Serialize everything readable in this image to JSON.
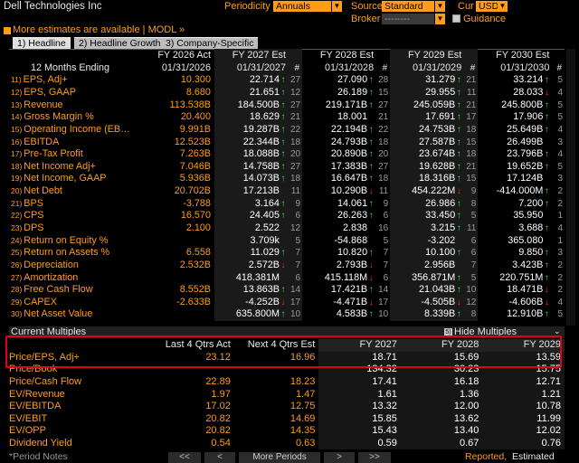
{
  "header": {
    "title": "Dell Technologies Inc",
    "periodicity_label": "Periodicity",
    "periodicity_value": "Annuals",
    "source_label": "Source",
    "source_value": "Standard",
    "cur_label": "Cur",
    "cur_value": "USD",
    "broker_label": "Broker",
    "broker_value": "--------",
    "guidance_label": "Guidance"
  },
  "notice": {
    "icon": "square-icon",
    "text": "More estimates are available | MODL »"
  },
  "tabs": [
    {
      "label": "1) Headline"
    },
    {
      "label": "2) Headline Growth"
    },
    {
      "label": "3) Company-Specific"
    }
  ],
  "columns": {
    "c1_top": "FY 2026 Act",
    "c1_bot": "01/31/2026",
    "c2_top": "FY 2027 Est",
    "c2_bot": "01/31/2027",
    "c3_top": "FY 2028 Est",
    "c3_bot": "01/31/2028",
    "c4_top": "FY 2029 Est",
    "c4_bot": "01/31/2029",
    "c5_top": "FY 2030 Est",
    "c5_bot": "01/31/2030",
    "row_label": "12 Months Ending",
    "hash": "#"
  },
  "rows": [
    {
      "n": "11)",
      "label": "EPS, Adj+",
      "a": "10.300",
      "b": "22.714",
      "ba": "u",
      "bn": "27",
      "c": "27.090",
      "ca": "u",
      "cn": "28",
      "d": "31.279",
      "da": "u",
      "dn": "21",
      "e": "33.214",
      "ea": "u",
      "en": "5"
    },
    {
      "n": "12)",
      "label": "EPS, GAAP",
      "a": "8.680",
      "b": "21.651",
      "ba": "u",
      "bn": "12",
      "c": "26.189",
      "ca": "u",
      "cn": "15",
      "d": "29.955",
      "da": "u",
      "dn": "11",
      "e": "28.033",
      "ea": "d",
      "en": "4"
    },
    {
      "n": "13)",
      "label": "Revenue",
      "a": "113.538B",
      "b": "184.500B",
      "ba": "u",
      "bn": "27",
      "c": "219.171B",
      "ca": "u",
      "cn": "27",
      "d": "245.059B",
      "da": "u",
      "dn": "21",
      "e": "245.800B",
      "ea": "u",
      "en": "5"
    },
    {
      "n": "14)",
      "label": "Gross Margin %",
      "a": "20.400",
      "b": "18.629",
      "ba": "u",
      "bn": "21",
      "c": "18.001",
      "ca": "",
      "cn": "21",
      "d": "17.691",
      "da": "u",
      "dn": "17",
      "e": "17.906",
      "ea": "u",
      "en": "5"
    },
    {
      "n": "15)",
      "label": "Operating Income (EB…",
      "a": "9.991B",
      "b": "19.287B",
      "ba": "u",
      "bn": "22",
      "c": "22.194B",
      "ca": "u",
      "cn": "22",
      "d": "24.753B",
      "da": "u",
      "dn": "18",
      "e": "25.649B",
      "ea": "u",
      "en": "4"
    },
    {
      "n": "16)",
      "label": "EBITDA",
      "a": "12.523B",
      "b": "22.344B",
      "ba": "u",
      "bn": "18",
      "c": "24.793B",
      "ca": "u",
      "cn": "18",
      "d": "27.587B",
      "da": "u",
      "dn": "15",
      "e": "26.499B",
      "ea": "",
      "en": "3"
    },
    {
      "n": "17)",
      "label": "Pre-Tax Profit",
      "a": "7.263B",
      "b": "18.088B",
      "ba": "u",
      "bn": "20",
      "c": "20.890B",
      "ca": "u",
      "cn": "20",
      "d": "23.674B",
      "da": "u",
      "dn": "18",
      "e": "23.796B",
      "ea": "u",
      "en": "4"
    },
    {
      "n": "18)",
      "label": "Net Income Adj+",
      "a": "7.046B",
      "b": "14.758B",
      "ba": "u",
      "bn": "27",
      "c": "17.383B",
      "ca": "u",
      "cn": "27",
      "d": "19.628B",
      "da": "u",
      "dn": "21",
      "e": "19.652B",
      "ea": "u",
      "en": "5"
    },
    {
      "n": "19)",
      "label": "Net Income, GAAP",
      "a": "5.936B",
      "b": "14.073B",
      "ba": "u",
      "bn": "18",
      "c": "16.647B",
      "ca": "u",
      "cn": "18",
      "d": "18.316B",
      "da": "u",
      "dn": "15",
      "e": "17.124B",
      "ea": "",
      "en": "3"
    },
    {
      "n": "20)",
      "label": "Net Debt",
      "a": "20.702B",
      "b": "17.213B",
      "ba": "",
      "bn": "11",
      "c": "10.290B",
      "ca": "d",
      "cn": "11",
      "d": "454.222M",
      "da": "d",
      "dn": "9",
      "e": "-414.000M",
      "ea": "u",
      "en": "2"
    },
    {
      "n": "21)",
      "label": "BPS",
      "a": "-3.788",
      "b": "3.164",
      "ba": "u",
      "bn": "9",
      "c": "14.061",
      "ca": "u",
      "cn": "9",
      "d": "26.986",
      "da": "u",
      "dn": "8",
      "e": "7.200",
      "ea": "u",
      "en": "2"
    },
    {
      "n": "22)",
      "label": "CPS",
      "a": "16.570",
      "b": "24.405",
      "ba": "u",
      "bn": "6",
      "c": "26.263",
      "ca": "u",
      "cn": "6",
      "d": "33.450",
      "da": "u",
      "dn": "5",
      "e": "35.950",
      "ea": "",
      "en": "1"
    },
    {
      "n": "23)",
      "label": "DPS",
      "a": "2.100",
      "b": "2.522",
      "ba": "",
      "bn": "12",
      "c": "2.838",
      "ca": "",
      "cn": "16",
      "d": "3.215",
      "da": "u",
      "dn": "11",
      "e": "3.688",
      "ea": "u",
      "en": "4"
    },
    {
      "n": "24)",
      "label": "Return on Equity %",
      "a": "",
      "b": "3.709k",
      "ba": "",
      "bn": "5",
      "c": "-54.868",
      "ca": "",
      "cn": "5",
      "d": "-3.202",
      "da": "",
      "dn": "6",
      "e": "365.080",
      "ea": "",
      "en": "1"
    },
    {
      "n": "25)",
      "label": "Return on Assets %",
      "a": "6.558",
      "b": "11.029",
      "ba": "u",
      "bn": "7",
      "c": "10.820",
      "ca": "u",
      "cn": "7",
      "d": "10.100",
      "da": "u",
      "dn": "6",
      "e": "9.850",
      "ea": "u",
      "en": "3"
    },
    {
      "n": "26)",
      "label": "Depreciation",
      "a": "2.532B",
      "b": "2.572B",
      "ba": "d",
      "bn": "7",
      "c": "2.793B",
      "ca": "d",
      "cn": "7",
      "d": "2.956B",
      "da": "",
      "dn": "7",
      "e": "3.423B",
      "ea": "u",
      "en": "2"
    },
    {
      "n": "27)",
      "label": "Amortization",
      "a": "",
      "b": "418.381M",
      "ba": "",
      "bn": "6",
      "c": "415.118M",
      "ca": "d",
      "cn": "6",
      "d": "356.871M",
      "da": "u",
      "dn": "5",
      "e": "220.751M",
      "ea": "u",
      "en": "2"
    },
    {
      "n": "28)",
      "label": "Free Cash Flow",
      "a": "8.552B",
      "b": "13.863B",
      "ba": "u",
      "bn": "14",
      "c": "17.421B",
      "ca": "u",
      "cn": "14",
      "d": "21.043B",
      "da": "u",
      "dn": "10",
      "e": "18.471B",
      "ea": "d",
      "en": "2"
    },
    {
      "n": "29)",
      "label": "CAPEX",
      "a": "-2.633B",
      "b": "-4.252B",
      "ba": "d",
      "bn": "17",
      "c": "-4.471B",
      "ca": "d",
      "cn": "17",
      "d": "-4.505B",
      "da": "d",
      "dn": "12",
      "e": "-4.606B",
      "ea": "d",
      "en": "4"
    },
    {
      "n": "30)",
      "label": "Net Asset Value",
      "a": "",
      "b": "635.800M",
      "ba": "u",
      "bn": "10",
      "c": "4.583B",
      "ca": "u",
      "cn": "10",
      "d": "8.339B",
      "da": "u",
      "dn": "8",
      "e": "12.910B",
      "ea": "u",
      "en": "5"
    }
  ],
  "multiples": {
    "title": "Current Multiples",
    "hide_label": "Hide Multiples",
    "hide_num": "5)",
    "headers": [
      "Last 4 Qtrs Act",
      "Next 4 Qtrs Est",
      "FY 2027",
      "FY 2028",
      "FY 2029"
    ],
    "rows": [
      {
        "label": "Price/EPS, Adj+",
        "v": [
          "23.12",
          "16.96",
          "18.71",
          "15.69",
          "13.59"
        ]
      },
      {
        "label": "Price/Book",
        "v": [
          "",
          "",
          "134.32",
          "30.23",
          "15.75"
        ]
      },
      {
        "label": "Price/Cash Flow",
        "v": [
          "22.89",
          "18.23",
          "17.41",
          "16.18",
          "12.71"
        ]
      },
      {
        "label": "EV/Revenue",
        "v": [
          "1.97",
          "1.47",
          "1.61",
          "1.36",
          "1.21"
        ]
      },
      {
        "label": "EV/EBITDA",
        "v": [
          "17.02",
          "12.75",
          "13.32",
          "12.00",
          "10.78"
        ]
      },
      {
        "label": "EV/EBIT",
        "v": [
          "20.82",
          "14.69",
          "15.85",
          "13.62",
          "11.99"
        ]
      },
      {
        "label": "EV/OPP",
        "v": [
          "20.82",
          "14.35",
          "15.43",
          "13.40",
          "12.02"
        ]
      },
      {
        "label": "Dividend Yield",
        "v": [
          "0.54",
          "0.63",
          "0.59",
          "0.67",
          "0.76"
        ]
      }
    ]
  },
  "footer": {
    "period_notes": "*Period Notes",
    "prev": "<<",
    "prev1": "<",
    "more_periods": "More Periods",
    "next1": ">",
    "next": ">>",
    "reported": "Reported,",
    "estimated": "Estimated"
  },
  "colors": {
    "orange": "#ff9c1a",
    "green": "#3fe34a",
    "red": "#ff2a2a",
    "highlight": "#e0001a"
  }
}
